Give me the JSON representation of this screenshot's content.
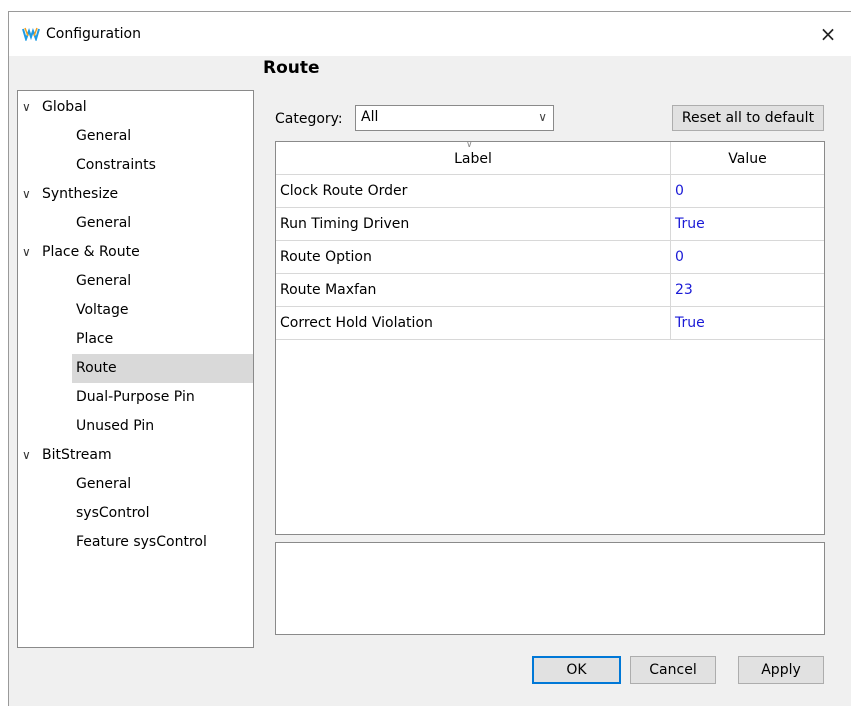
{
  "window": {
    "title": "Configuration",
    "close": "×"
  },
  "page": {
    "title": "Route"
  },
  "tree": [
    {
      "label": "Global",
      "level": 0,
      "expanded": true
    },
    {
      "label": "General",
      "level": 1
    },
    {
      "label": "Constraints",
      "level": 1
    },
    {
      "label": "Synthesize",
      "level": 0,
      "expanded": true
    },
    {
      "label": "General",
      "level": 1
    },
    {
      "label": "Place & Route",
      "level": 0,
      "expanded": true
    },
    {
      "label": "General",
      "level": 1
    },
    {
      "label": "Voltage",
      "level": 1
    },
    {
      "label": "Place",
      "level": 1
    },
    {
      "label": "Route",
      "level": 1,
      "selected": true
    },
    {
      "label": "Dual-Purpose Pin",
      "level": 1
    },
    {
      "label": "Unused Pin",
      "level": 1
    },
    {
      "label": "BitStream",
      "level": 0,
      "expanded": true
    },
    {
      "label": "General",
      "level": 1
    },
    {
      "label": "sysControl",
      "level": 1
    },
    {
      "label": "Feature sysControl",
      "level": 1
    }
  ],
  "category": {
    "label": "Category:",
    "value": "All"
  },
  "reset_button": "Reset all to default",
  "grid": {
    "headers": {
      "label": "Label",
      "value": "Value"
    },
    "rows": [
      {
        "label": "Clock Route Order",
        "value": "0"
      },
      {
        "label": "Run Timing Driven",
        "value": "True"
      },
      {
        "label": "Route Option",
        "value": "0"
      },
      {
        "label": "Route Maxfan",
        "value": "23"
      },
      {
        "label": "Correct Hold Violation",
        "value": "True"
      }
    ]
  },
  "buttons": {
    "ok": "OK",
    "cancel": "Cancel",
    "apply": "Apply"
  },
  "colors": {
    "value_text": "#1a1ad6",
    "selected_bg": "#d9d9d9",
    "ok_border": "#0078d7"
  },
  "icons": {
    "app": "gowin-logo-icon",
    "expand": "chevron-down-icon",
    "sort": "sort-indicator-icon"
  }
}
